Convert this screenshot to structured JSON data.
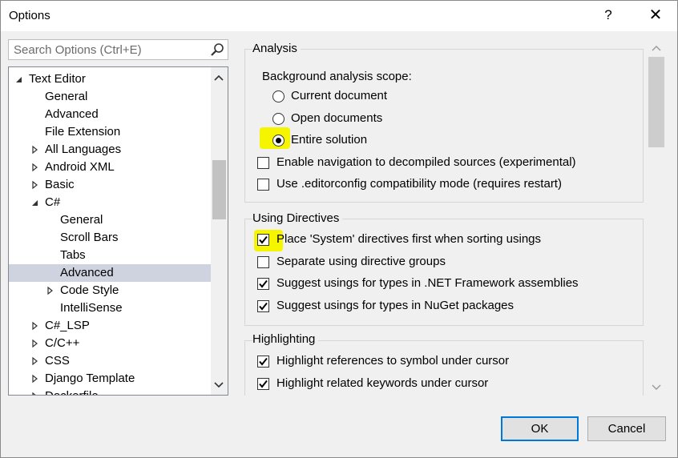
{
  "window": {
    "title": "Options",
    "help_label": "?",
    "close_label": "✕"
  },
  "search": {
    "placeholder": "Search Options (Ctrl+E)"
  },
  "tree": {
    "items": [
      {
        "label": "Text Editor",
        "expander": "expanded",
        "level": 0
      },
      {
        "label": "General",
        "expander": "none",
        "level": 1
      },
      {
        "label": "Advanced",
        "expander": "none",
        "level": 1
      },
      {
        "label": "File Extension",
        "expander": "none",
        "level": 1
      },
      {
        "label": "All Languages",
        "expander": "collapsed",
        "level": 1
      },
      {
        "label": "Android XML",
        "expander": "collapsed",
        "level": 1
      },
      {
        "label": "Basic",
        "expander": "collapsed",
        "level": 1
      },
      {
        "label": "C#",
        "expander": "expanded",
        "level": 1
      },
      {
        "label": "General",
        "expander": "none",
        "level": 2
      },
      {
        "label": "Scroll Bars",
        "expander": "none",
        "level": 2
      },
      {
        "label": "Tabs",
        "expander": "none",
        "level": 2
      },
      {
        "label": "Advanced",
        "expander": "none",
        "level": 2,
        "selected": true
      },
      {
        "label": "Code Style",
        "expander": "collapsed",
        "level": 2
      },
      {
        "label": "IntelliSense",
        "expander": "none",
        "level": 2
      },
      {
        "label": "C#_LSP",
        "expander": "collapsed",
        "level": 1
      },
      {
        "label": "C/C++",
        "expander": "collapsed",
        "level": 1
      },
      {
        "label": "CSS",
        "expander": "collapsed",
        "level": 1
      },
      {
        "label": "Django Template",
        "expander": "collapsed",
        "level": 1
      },
      {
        "label": "Dockerfile",
        "expander": "collapsed",
        "level": 1
      }
    ]
  },
  "analysis": {
    "heading": "Analysis",
    "scope_label": "Background analysis scope:",
    "scope_options": [
      {
        "label": "Current document",
        "selected": false
      },
      {
        "label": "Open documents",
        "selected": false
      },
      {
        "label": "Entire solution",
        "selected": true
      }
    ],
    "options": [
      {
        "label": "Enable navigation to decompiled sources (experimental)",
        "checked": false
      },
      {
        "label": "Use .editorconfig compatibility mode (requires restart)",
        "checked": false
      }
    ]
  },
  "using_directives": {
    "heading": "Using Directives",
    "options": [
      {
        "label": "Place 'System' directives first when sorting usings",
        "checked": true
      },
      {
        "label": "Separate using directive groups",
        "checked": false
      },
      {
        "label": "Suggest usings for types in .NET Framework assemblies",
        "checked": true
      },
      {
        "label": "Suggest usings for types in NuGet packages",
        "checked": true
      }
    ]
  },
  "highlighting": {
    "heading": "Highlighting",
    "options": [
      {
        "label": "Highlight references to symbol under cursor",
        "checked": true
      },
      {
        "label": "Highlight related keywords under cursor",
        "checked": true
      }
    ]
  },
  "buttons": {
    "ok": "OK",
    "cancel": "Cancel"
  },
  "colors": {
    "highlight": "#f5f500",
    "selection": "#cfd3df",
    "default_button_border": "#0078d7"
  }
}
